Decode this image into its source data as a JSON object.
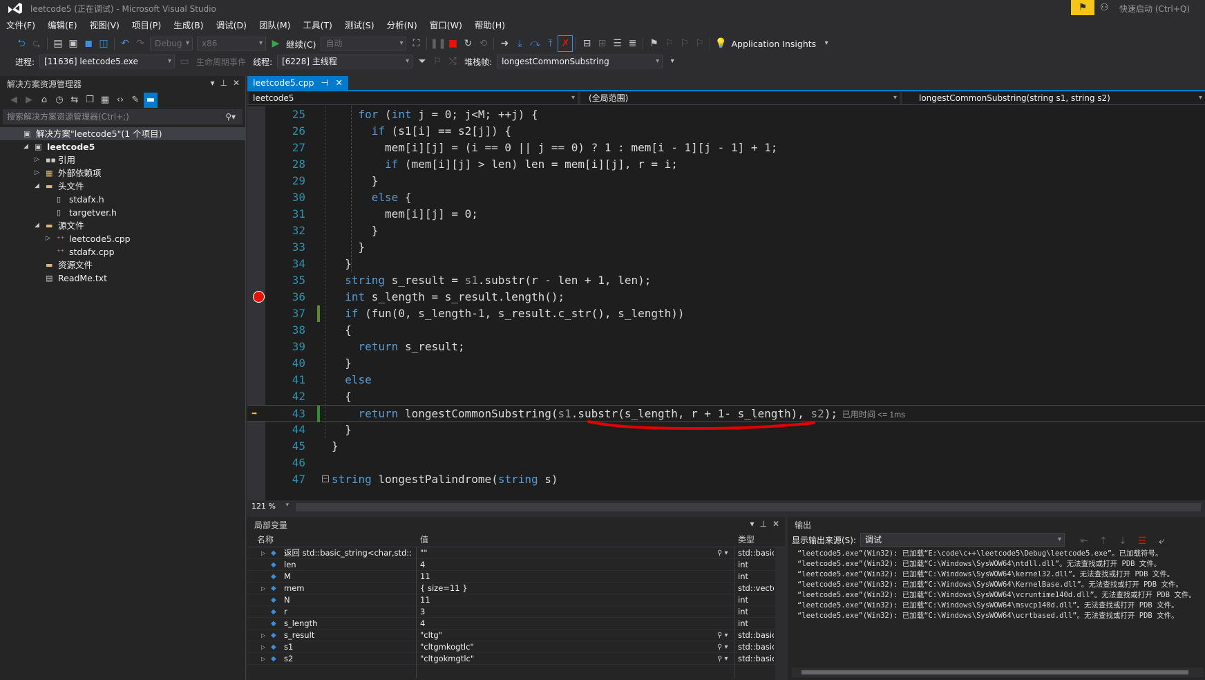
{
  "window": {
    "title": "leetcode5 (正在调试) - Microsoft Visual Studio",
    "quick_launch": "快速启动 (Ctrl+Q)"
  },
  "menu": [
    "文件(F)",
    "编辑(E)",
    "视图(V)",
    "项目(P)",
    "生成(B)",
    "调试(D)",
    "团队(M)",
    "工具(T)",
    "测试(S)",
    "分析(N)",
    "窗口(W)",
    "帮助(H)"
  ],
  "toolbar": {
    "config": "Debug",
    "platform": "x86",
    "continue_label": "继续(C)",
    "auto_combo": "自动",
    "app_insights": "Application Insights"
  },
  "debug_bar": {
    "process_label": "进程:",
    "process_value": "[11636] leetcode5.exe",
    "lifecycle_label": "生命周期事件",
    "thread_label": "线程:",
    "thread_value": "[6228] 主线程",
    "stackframe_label": "堆栈帧:",
    "stackframe_value": "longestCommonSubstring"
  },
  "solution_explorer": {
    "title": "解决方案资源管理器",
    "search_placeholder": "搜索解决方案资源管理器(Ctrl+;)",
    "items": [
      {
        "label": "解决方案\"leetcode5\"(1 个项目)",
        "indent": 0,
        "arrow": "",
        "icon": "solution-icon",
        "bold": false,
        "selected": true
      },
      {
        "label": "leetcode5",
        "indent": 1,
        "arrow": "◢",
        "icon": "project-icon",
        "bold": true,
        "selected": false
      },
      {
        "label": "引用",
        "indent": 2,
        "arrow": "▷",
        "icon": "references-icon",
        "bold": false,
        "selected": false
      },
      {
        "label": "外部依赖项",
        "indent": 2,
        "arrow": "▷",
        "icon": "external-deps-icon",
        "bold": false,
        "selected": false
      },
      {
        "label": "头文件",
        "indent": 2,
        "arrow": "◢",
        "icon": "folder-icon",
        "bold": false,
        "selected": false
      },
      {
        "label": "stdafx.h",
        "indent": 3,
        "arrow": "",
        "icon": "header-file-icon",
        "bold": false,
        "selected": false
      },
      {
        "label": "targetver.h",
        "indent": 3,
        "arrow": "",
        "icon": "header-file-icon",
        "bold": false,
        "selected": false
      },
      {
        "label": "源文件",
        "indent": 2,
        "arrow": "◢",
        "icon": "folder-icon",
        "bold": false,
        "selected": false
      },
      {
        "label": "leetcode5.cpp",
        "indent": 3,
        "arrow": "▷",
        "icon": "cpp-file-icon",
        "bold": false,
        "selected": false
      },
      {
        "label": "stdafx.cpp",
        "indent": 3,
        "arrow": "",
        "icon": "cpp-file-icon",
        "bold": false,
        "selected": false
      },
      {
        "label": "资源文件",
        "indent": 2,
        "arrow": "",
        "icon": "folder-icon",
        "bold": false,
        "selected": false
      },
      {
        "label": "ReadMe.txt",
        "indent": 2,
        "arrow": "",
        "icon": "text-file-icon",
        "bold": false,
        "selected": false
      }
    ]
  },
  "editor": {
    "tab": "leetcode5.cpp",
    "nav_project": "leetcode5",
    "nav_scope": "(全局范围)",
    "nav_member": "longestCommonSubstring(string s1, string s2)",
    "zoom": "121 %",
    "elapsed": "已用时间 <= 1ms",
    "lines": [
      {
        "n": "25",
        "indent": 4,
        "code": "for (int j = 0; j<M; ++j) {",
        "kw": [
          "for",
          "int"
        ]
      },
      {
        "n": "26",
        "indent": 6,
        "code": "if (s1[i] == s2[j]) {",
        "kw": [
          "if"
        ]
      },
      {
        "n": "27",
        "indent": 8,
        "code": "mem[i][j] = (i == 0 || j == 0) ? 1 : mem[i - 1][j - 1] + 1;",
        "kw": []
      },
      {
        "n": "28",
        "indent": 8,
        "code": "if (mem[i][j] > len) len = mem[i][j], r = i;",
        "kw": [
          "if"
        ]
      },
      {
        "n": "29",
        "indent": 6,
        "code": "}",
        "kw": []
      },
      {
        "n": "30",
        "indent": 6,
        "code": "else {",
        "kw": [
          "else"
        ]
      },
      {
        "n": "31",
        "indent": 8,
        "code": "mem[i][j] = 0;",
        "kw": []
      },
      {
        "n": "32",
        "indent": 6,
        "code": "}",
        "kw": []
      },
      {
        "n": "33",
        "indent": 4,
        "code": "}",
        "kw": []
      },
      {
        "n": "34",
        "indent": 2,
        "code": "}",
        "kw": []
      },
      {
        "n": "35",
        "indent": 2,
        "code": "string s_result = s1.substr(r - len + 1, len);",
        "kw": [
          "string"
        ]
      },
      {
        "n": "36",
        "indent": 2,
        "code": "int s_length = s_result.length();",
        "kw": [
          "int"
        ]
      },
      {
        "n": "37",
        "indent": 2,
        "code": "if (fun(0, s_length-1, s_result.c_str(), s_length))",
        "kw": [
          "if"
        ]
      },
      {
        "n": "38",
        "indent": 2,
        "code": "{",
        "kw": []
      },
      {
        "n": "39",
        "indent": 4,
        "code": "return s_result;",
        "kw": [
          "return"
        ]
      },
      {
        "n": "40",
        "indent": 2,
        "code": "}",
        "kw": []
      },
      {
        "n": "41",
        "indent": 2,
        "code": "else",
        "kw": [
          "else"
        ]
      },
      {
        "n": "42",
        "indent": 2,
        "code": "{",
        "kw": []
      },
      {
        "n": "43",
        "indent": 4,
        "code": "return longestCommonSubstring(s1.substr(s_length, r + 1- s_length), s2);",
        "kw": [
          "return"
        ]
      },
      {
        "n": "44",
        "indent": 2,
        "code": "}",
        "kw": []
      },
      {
        "n": "45",
        "indent": 0,
        "code": "}",
        "kw": []
      },
      {
        "n": "46",
        "indent": 0,
        "code": "",
        "kw": []
      },
      {
        "n": "47",
        "indent": 0,
        "code": "string longestPalindrome(string s)",
        "kw": [
          "string"
        ]
      }
    ],
    "breakpoint_line": "36",
    "current_line": "43"
  },
  "locals": {
    "title": "局部变量",
    "col_name": "名称",
    "col_value": "值",
    "col_type": "类型",
    "rows": [
      {
        "name": "返回 std::basic_string<char,std::char_traits<char>,std::allocator<char> >",
        "value": "\"\"",
        "type": "std::basic_string",
        "expand": true,
        "search": true
      },
      {
        "name": "len",
        "value": "4",
        "type": "int",
        "expand": false,
        "search": false
      },
      {
        "name": "M",
        "value": "11",
        "type": "int",
        "expand": false,
        "search": false
      },
      {
        "name": "mem",
        "value": "{ size=11 }",
        "type": "std::vector",
        "expand": true,
        "search": false
      },
      {
        "name": "N",
        "value": "11",
        "type": "int",
        "expand": false,
        "search": false
      },
      {
        "name": "r",
        "value": "3",
        "type": "int",
        "expand": false,
        "search": false
      },
      {
        "name": "s_length",
        "value": "4",
        "type": "int",
        "expand": false,
        "search": false
      },
      {
        "name": "s_result",
        "value": "\"cltg\"",
        "type": "std::basic_string",
        "expand": true,
        "search": true
      },
      {
        "name": "s1",
        "value": "\"cltgmkogtlc\"",
        "type": "std::basic_string",
        "expand": true,
        "search": true
      },
      {
        "name": "s2",
        "value": "\"cltgokmgtlc\"",
        "type": "std::basic_string",
        "expand": true,
        "search": true
      }
    ]
  },
  "output": {
    "title": "输出",
    "source_label": "显示输出来源(S):",
    "source_value": "调试",
    "lines": [
      "“leetcode5.exe”(Win32): 已加载“E:\\code\\c++\\leetcode5\\Debug\\leetcode5.exe”。已加载符号。",
      "“leetcode5.exe”(Win32): 已加载“C:\\Windows\\SysWOW64\\ntdll.dll”。无法查找或打开 PDB 文件。",
      "“leetcode5.exe”(Win32): 已加载“C:\\Windows\\SysWOW64\\kernel32.dll”。无法查找或打开 PDB 文件。",
      "“leetcode5.exe”(Win32): 已加载“C:\\Windows\\SysWOW64\\KernelBase.dll”。无法查找或打开 PDB 文件。",
      "“leetcode5.exe”(Win32): 已加载“C:\\Windows\\SysWOW64\\vcruntime140d.dll”。无法查找或打开 PDB 文件。",
      "“leetcode5.exe”(Win32): 已加载“C:\\Windows\\SysWOW64\\msvcp140d.dll”。无法查找或打开 PDB 文件。",
      "“leetcode5.exe”(Win32): 已加载“C:\\Windows\\SysWOW64\\ucrtbased.dll”。无法查找或打开 PDB 文件。"
    ]
  },
  "colors": {
    "accent": "#007acc",
    "keyword": "#569cd6",
    "line_number": "#2b91af",
    "breakpoint": "#e51400",
    "annotation": "#e50000"
  }
}
